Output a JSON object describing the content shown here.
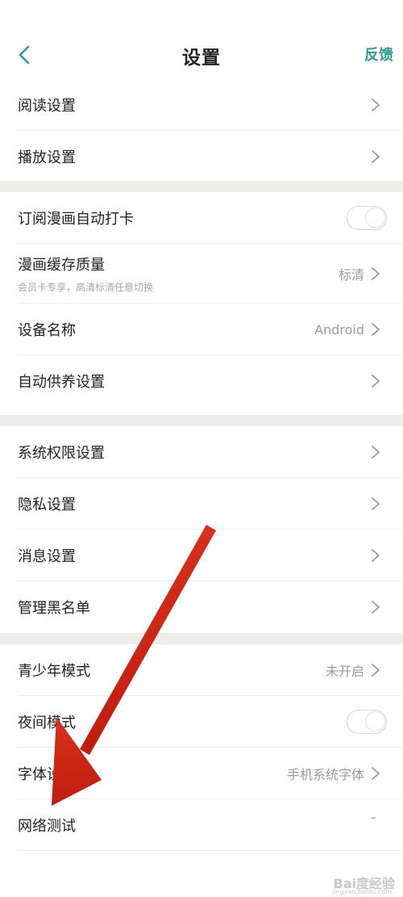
{
  "colors": {
    "accent": "#2e9e8f",
    "text": "#222222",
    "muted": "#9a9a9a",
    "section_gap": "#efedea",
    "arrow": "#d02414"
  },
  "header": {
    "title": "设置",
    "feedback_label": "反馈",
    "back_icon": "chevron-left-icon"
  },
  "sections": {
    "s1": {
      "read_settings": "阅读设置",
      "play_settings": "播放设置"
    },
    "s2": {
      "auto_checkin": "订阅漫画自动打卡",
      "auto_checkin_on": false,
      "cache_quality": "漫画缓存质量",
      "cache_quality_sub": "会员卡专享，高清标清任意切换",
      "cache_quality_value": "标清",
      "device_name": "设备名称",
      "device_name_value": "Android",
      "auto_feed": "自动供养设置"
    },
    "s3": {
      "system_permissions": "系统权限设置",
      "privacy_settings": "隐私设置",
      "message_settings": "消息设置",
      "blacklist": "管理黑名单"
    },
    "s4": {
      "youth_mode": "青少年模式",
      "youth_mode_value": "未开启",
      "night_mode": "夜间模式",
      "night_mode_on": false,
      "font_settings": "字体设置",
      "font_settings_value": "手机系统字体",
      "network_test": "网络测试"
    }
  },
  "watermark": {
    "logo": "Bai度经验",
    "url": "jingyan.baidu.com"
  }
}
